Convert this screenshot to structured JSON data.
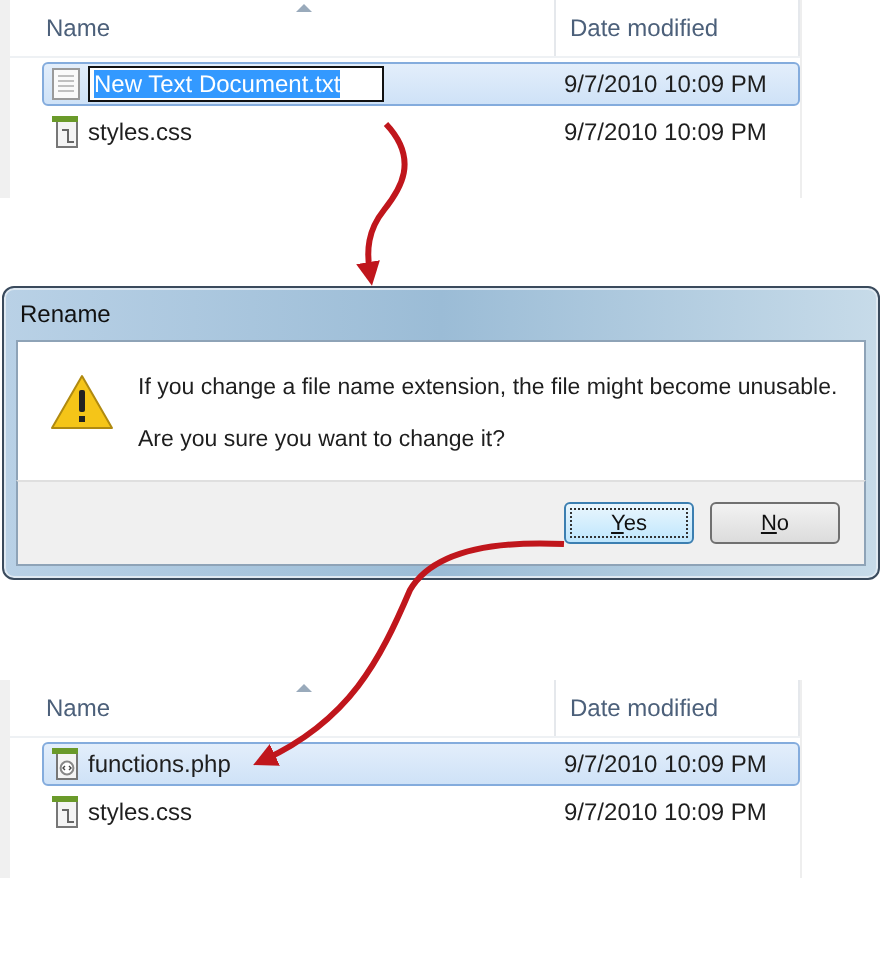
{
  "explorer_before": {
    "columns": [
      "Name",
      "Date modified"
    ],
    "files": [
      {
        "name": "New Text Document.txt",
        "date": "9/7/2010 10:09 PM",
        "kind": "text",
        "selected": true,
        "editing": true
      },
      {
        "name": "styles.css",
        "date": "9/7/2010 10:09 PM",
        "kind": "css",
        "selected": false,
        "editing": false
      }
    ]
  },
  "dialog": {
    "title": "Rename",
    "message": "If you change a file name extension, the file might become unusable.",
    "question": "Are you sure you want to change it?",
    "buttons": [
      {
        "label": "Yes",
        "default": true
      },
      {
        "label": "No",
        "default": false
      }
    ]
  },
  "explorer_after": {
    "columns": [
      "Name",
      "Date modified"
    ],
    "files": [
      {
        "name": "functions.php",
        "date": "9/7/2010 10:09 PM",
        "kind": "php",
        "selected": true,
        "editing": false
      },
      {
        "name": "styles.css",
        "date": "9/7/2010 10:09 PM",
        "kind": "css",
        "selected": false,
        "editing": false
      }
    ]
  }
}
